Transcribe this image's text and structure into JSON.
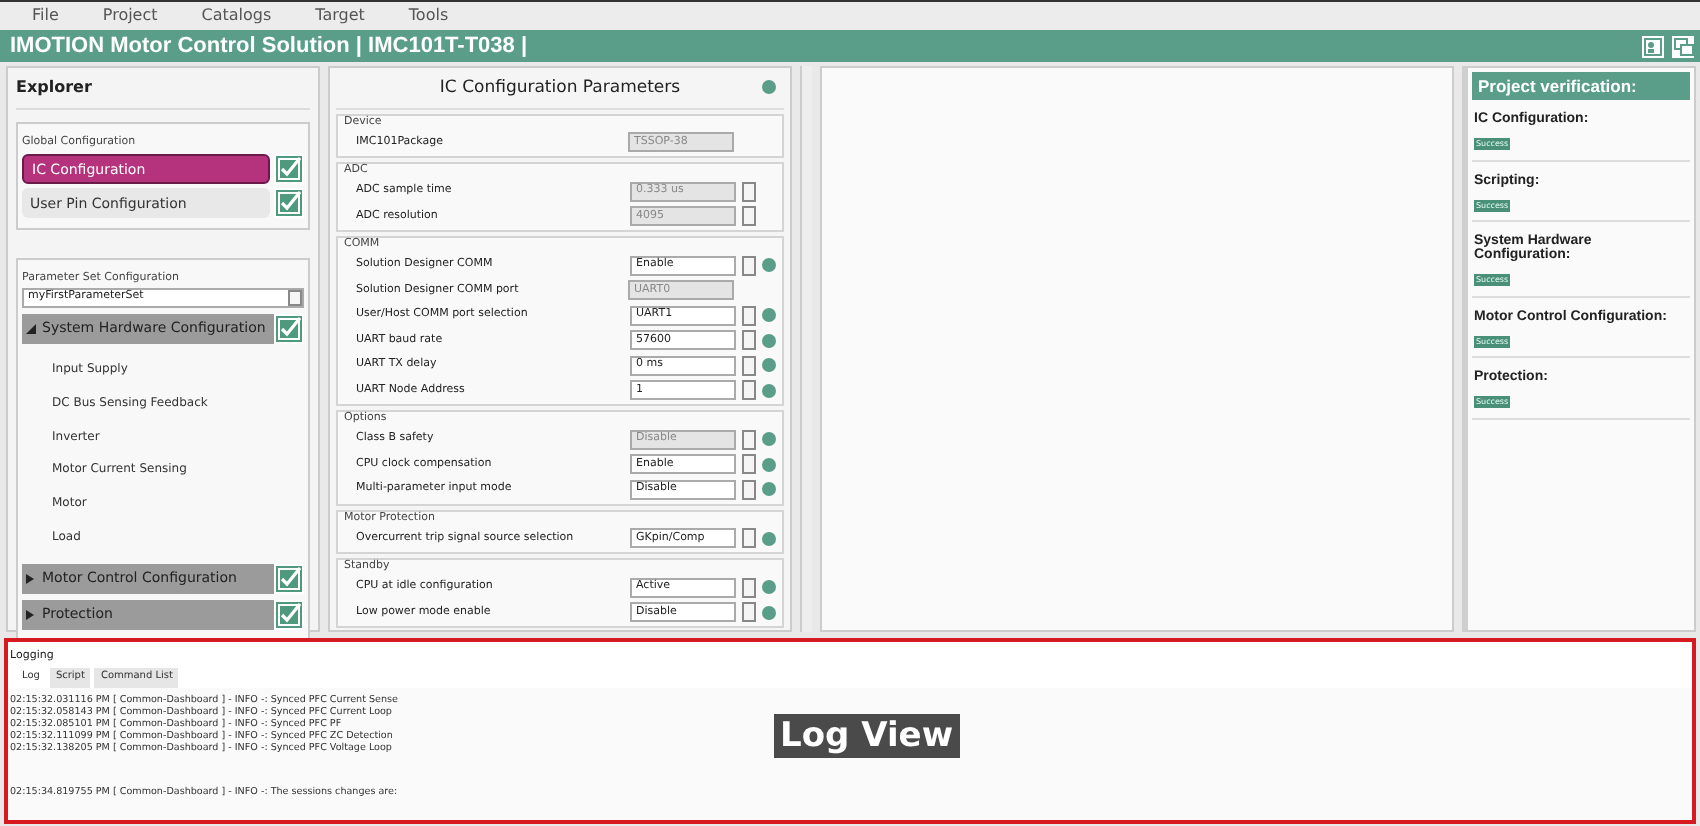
{
  "menu": [
    "File",
    "Project",
    "Catalogs",
    "Target",
    "Tools"
  ],
  "title": "IMOTION Motor Control Solution   | IMC101T-T038 |",
  "explorer": {
    "title": "Explorer",
    "global": {
      "legend": "Global Configuration",
      "items": [
        {
          "label": "IC Configuration",
          "selected": true,
          "checked": true
        },
        {
          "label": "User Pin Configuration",
          "selected": false,
          "checked": true
        }
      ]
    },
    "parameter_set": {
      "legend": "Parameter Set Configuration",
      "value": "myFirstParameterSet",
      "sections": [
        {
          "label": "System Hardware Configuration",
          "expanded": true,
          "checked": true,
          "children": [
            {
              "label": "Input Supply"
            },
            {
              "label": "DC Bus Sensing Feedback"
            },
            {
              "label": "Inverter"
            },
            {
              "label": "Motor Current Sensing"
            },
            {
              "label": "Motor"
            },
            {
              "label": "Load"
            }
          ]
        },
        {
          "label": "Motor Control Configuration",
          "expanded": false,
          "checked": true
        },
        {
          "label": "Protection",
          "expanded": false,
          "checked": true
        }
      ]
    }
  },
  "config": {
    "title": "IC Configuration Parameters",
    "groups": [
      {
        "legend": "Device",
        "rows": [
          {
            "label": "IMC101Package",
            "kind": "text",
            "value": "TSSOP-38",
            "disabled": true,
            "help": false
          }
        ]
      },
      {
        "legend": "ADC",
        "rows": [
          {
            "label": "ADC sample time",
            "kind": "spin",
            "value": "0.333 us",
            "disabled": true,
            "help": false
          },
          {
            "label": "ADC resolution",
            "kind": "spin",
            "value": "4095",
            "disabled": true,
            "help": false
          }
        ]
      },
      {
        "legend": "COMM",
        "rows": [
          {
            "label": "Solution Designer COMM",
            "kind": "select",
            "value": "Enable",
            "disabled": false,
            "help": true
          },
          {
            "label": "Solution Designer COMM port",
            "kind": "text",
            "value": "UART0",
            "disabled": true,
            "help": false
          },
          {
            "label": "User/Host COMM port selection",
            "kind": "select",
            "value": "UART1",
            "disabled": false,
            "help": true
          },
          {
            "label": "UART baud rate",
            "kind": "select",
            "value": "57600",
            "disabled": false,
            "help": true
          },
          {
            "label": "UART TX delay",
            "kind": "spin",
            "value": "0 ms",
            "disabled": false,
            "help": true
          },
          {
            "label": "UART Node Address",
            "kind": "spin",
            "value": "1",
            "disabled": false,
            "help": true
          }
        ]
      },
      {
        "legend": "Options",
        "rows": [
          {
            "label": "Class B safety",
            "kind": "select",
            "value": "Disable",
            "disabled": true,
            "help": true
          },
          {
            "label": "CPU clock compensation",
            "kind": "select",
            "value": "Enable",
            "disabled": false,
            "help": true
          },
          {
            "label": "Multi-parameter input mode",
            "kind": "select",
            "value": "Disable",
            "disabled": false,
            "help": true
          }
        ]
      },
      {
        "legend": "Motor Protection",
        "rows": [
          {
            "label": "Overcurrent trip signal source selection",
            "kind": "select",
            "value": "GKpin/Comp",
            "disabled": false,
            "help": true
          }
        ]
      },
      {
        "legend": "Standby",
        "rows": [
          {
            "label": "CPU at idle configuration",
            "kind": "select",
            "value": "Active",
            "disabled": false,
            "help": true
          },
          {
            "label": "Low power mode enable",
            "kind": "select",
            "value": "Disable",
            "disabled": false,
            "help": true
          }
        ]
      }
    ]
  },
  "verification": {
    "title": "Project verification:",
    "items": [
      {
        "label": "IC Configuration:",
        "status": "Success"
      },
      {
        "label": "Scripting:",
        "status": "Success"
      },
      {
        "label": "System Hardware Configuration:",
        "status": "Success"
      },
      {
        "label": "Motor Control Configuration:",
        "status": "Success"
      },
      {
        "label": "Protection:",
        "status": "Success"
      }
    ]
  },
  "logging": {
    "title": "Logging",
    "tabs": [
      {
        "label": "Log",
        "selected": true
      },
      {
        "label": "Script",
        "selected": false
      },
      {
        "label": "Command List",
        "selected": false
      }
    ],
    "lines": [
      "02:15:32.031116 PM [ Common-Dashboard ] - INFO -: Synced PFC Current Sense",
      "02:15:32.058143 PM [ Common-Dashboard ] - INFO -: Synced PFC Current Loop",
      "02:15:32.085101 PM [ Common-Dashboard ] - INFO -: Synced PFC PF",
      "02:15:32.111099 PM [ Common-Dashboard ] - INFO -: Synced PFC ZC Detection",
      "02:15:32.138205 PM [ Common-Dashboard ] - INFO -: Synced PFC Voltage Loop"
    ],
    "last_line": "02:15:34.819755 PM [ Common-Dashboard ] - INFO -: The sessions changes are:",
    "callout": "Log View"
  }
}
